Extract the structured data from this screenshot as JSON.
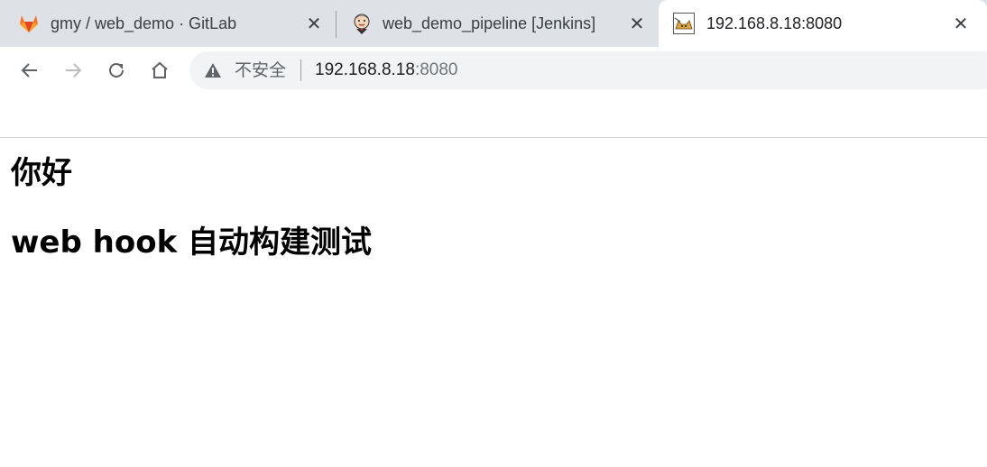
{
  "tabs": [
    {
      "title": "gmy / web_demo · GitLab",
      "icon": "gitlab-fox-icon",
      "close": "✕"
    },
    {
      "title": "web_demo_pipeline [Jenkins]",
      "icon": "jenkins-butler-icon",
      "close": "✕"
    },
    {
      "title": "192.168.8.18:8080",
      "icon": "tomcat-cat-icon",
      "close": "✕",
      "active": true
    }
  ],
  "toolbar": {
    "security_label": "不安全",
    "url_host": "192.168.8.18",
    "url_port": ":8080"
  },
  "page": {
    "heading1": "你好",
    "heading2": "web hook 自动构建测试"
  },
  "colors": {
    "tabstrip": "#dee1e6",
    "omnibox": "#f1f3f4",
    "gitlab_orange": "#fc6d26"
  }
}
